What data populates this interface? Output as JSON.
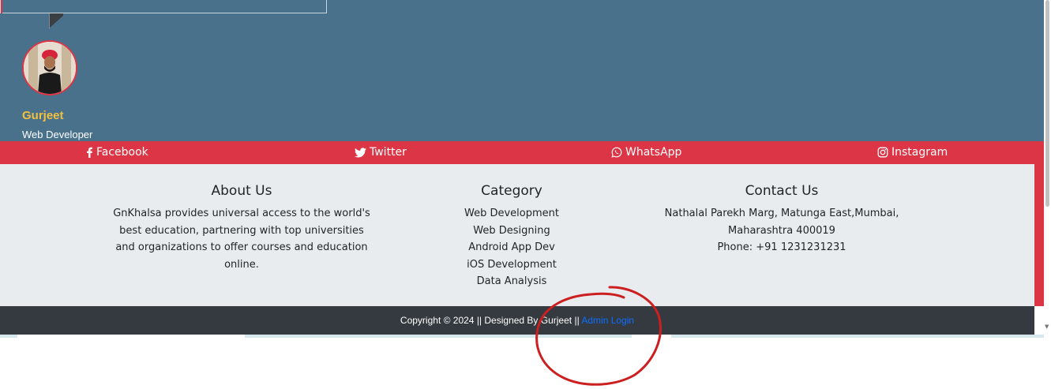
{
  "testimonial": {
    "author_name": "Gurjeet",
    "author_role": "Web Developer"
  },
  "social": [
    {
      "label": "Facebook",
      "icon": "facebook-icon"
    },
    {
      "label": "Twitter",
      "icon": "twitter-icon"
    },
    {
      "label": "WhatsApp",
      "icon": "whatsapp-icon"
    },
    {
      "label": "Instagram",
      "icon": "instagram-icon"
    }
  ],
  "footer": {
    "about": {
      "heading": "About Us",
      "lines": [
        "GnKhalsa provides universal access to the world's",
        "best education, partnering with top universities",
        "and organizations to offer courses and education",
        "online."
      ]
    },
    "category": {
      "heading": "Category",
      "items": [
        "Web Development",
        "Web Designing",
        "Android App Dev",
        "iOS Development",
        "Data Analysis"
      ]
    },
    "contact": {
      "heading": "Contact Us",
      "address_line1": "Nathalal Parekh Marg, Matunga East,Mumbai,",
      "address_line2": "Maharashtra 400019",
      "phone": "Phone: +91 1231231231"
    }
  },
  "copyright": {
    "text": "Copyright © 2024 || Designed By Gurjeet ||",
    "admin_link": "Admin Login"
  },
  "colors": {
    "band": "#4a718b",
    "accent_red": "#dc3545",
    "footer_bg": "#e9ecef",
    "copyright_bg": "#343a40",
    "link_blue": "#0d6efd",
    "name_yellow": "#f0c040"
  }
}
